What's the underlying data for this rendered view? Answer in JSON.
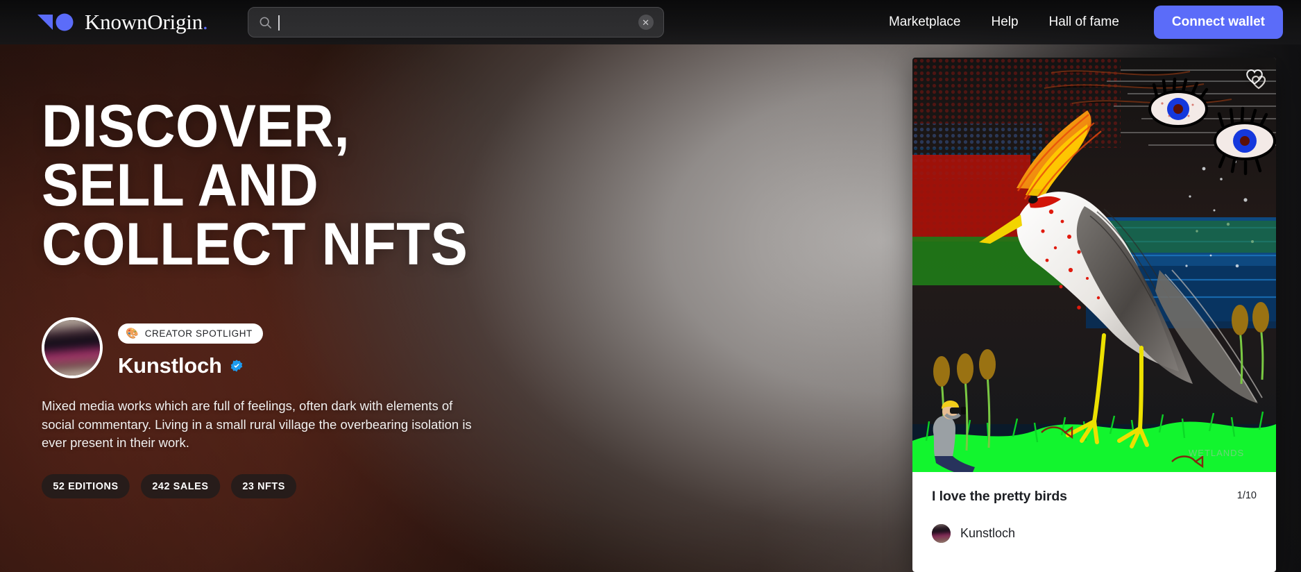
{
  "navbar": {
    "brand_name": "KnownOrigin",
    "brand_dot": ".",
    "logo_icon": "triangle-circle-logo",
    "search": {
      "icon": "search-icon",
      "value": "",
      "placeholder": "",
      "clear_icon": "clear-circle-icon",
      "clear_glyph": "✕"
    },
    "links": [
      {
        "label": "Marketplace",
        "name": "nav-link-marketplace"
      },
      {
        "label": "Help",
        "name": "nav-link-help"
      },
      {
        "label": "Hall of fame",
        "name": "nav-link-hall-of-fame"
      }
    ],
    "wallet_button": "Connect wallet"
  },
  "hero": {
    "title_lines": [
      "DISCOVER,",
      "SELL AND",
      "COLLECT NFTS"
    ],
    "badge": {
      "emoji": "🎨",
      "icon": "palette-emoji",
      "label": "CREATOR SPOTLIGHT"
    },
    "creator": {
      "name": "Kunstloch",
      "verified_icon": "verified-badge-icon",
      "avatar_icon": "creator-avatar"
    },
    "description": "Mixed media works which are full of feelings, often dark with elements of social commentary. Living in a small rural village the overbearing isolation is ever present in their work.",
    "stats": [
      {
        "label": "52 EDITIONS",
        "name": "stat-editions"
      },
      {
        "label": "242 SALES",
        "name": "stat-sales"
      },
      {
        "label": "23 NFTS",
        "name": "stat-nfts"
      }
    ]
  },
  "nft_card": {
    "artwork_alt": "abstract-bird-painting",
    "like_icon": "heart-outline-icon",
    "title": "I love the pretty birds",
    "edition": "1/10",
    "artist": "Kunstloch",
    "artist_avatar_icon": "artist-avatar"
  },
  "colors": {
    "accent": "#5B6CF9",
    "navbar_bg": "#0F0F10",
    "card_bg": "#FFFFFF",
    "text_dark": "#1D1F24",
    "verified_blue": "#1D9BF0",
    "hero_warm": "#6E2B1C"
  }
}
